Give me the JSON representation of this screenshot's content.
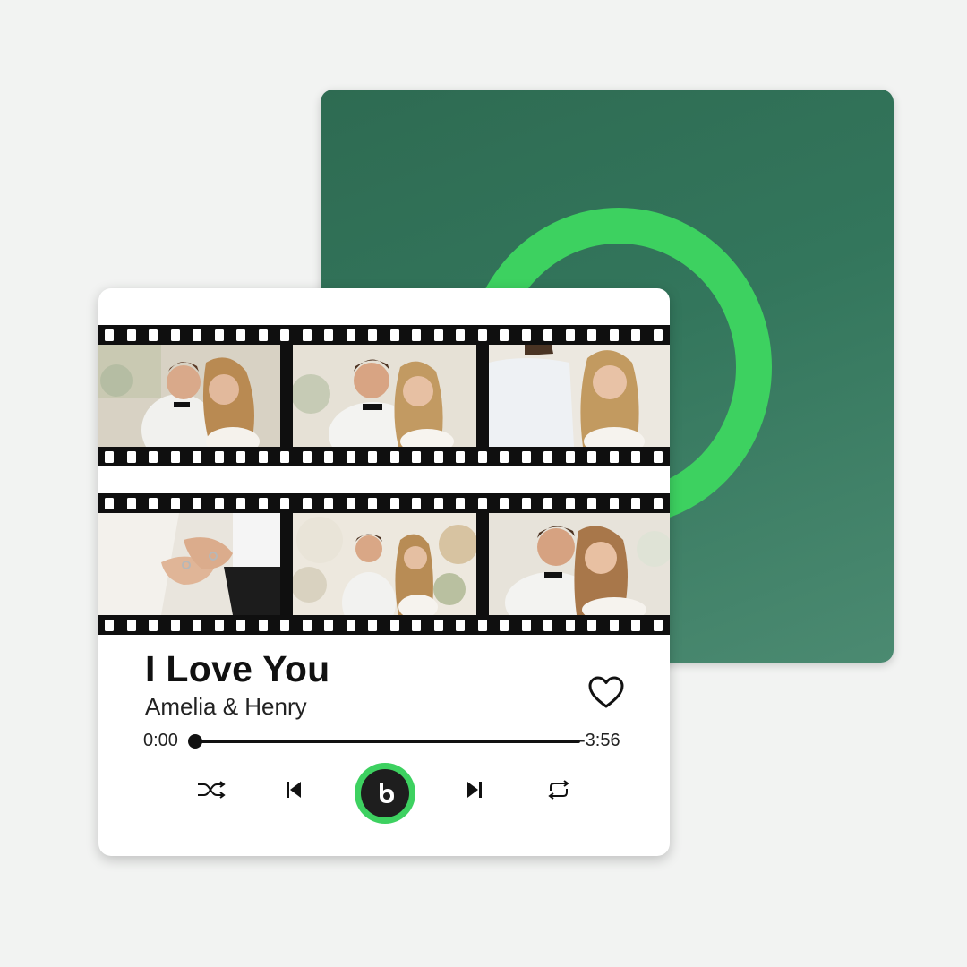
{
  "song": {
    "title": "I Love You",
    "artist": "Amelia & Henry",
    "time_elapsed": "0:00",
    "time_remaining": "-3:56",
    "progress": 0.0
  },
  "controls": {
    "shuffle_icon": "shuffle-icon",
    "previous_icon": "skip-previous-icon",
    "play_icon": "play-logo-icon",
    "next_icon": "skip-next-icon",
    "repeat_icon": "repeat-icon",
    "like_icon": "heart-outline-icon"
  },
  "photos": {
    "strip_1": [
      "couple-embrace-photo",
      "couple-smiling-photo",
      "bride-portrait-photo"
    ],
    "strip_2": [
      "hands-rings-photo",
      "couple-flowers-photo",
      "couple-closeup-photo"
    ]
  },
  "colors": {
    "accent_green": "#3dd160",
    "back_card_green": "#33765c",
    "film_black": "#0f0f0f"
  }
}
